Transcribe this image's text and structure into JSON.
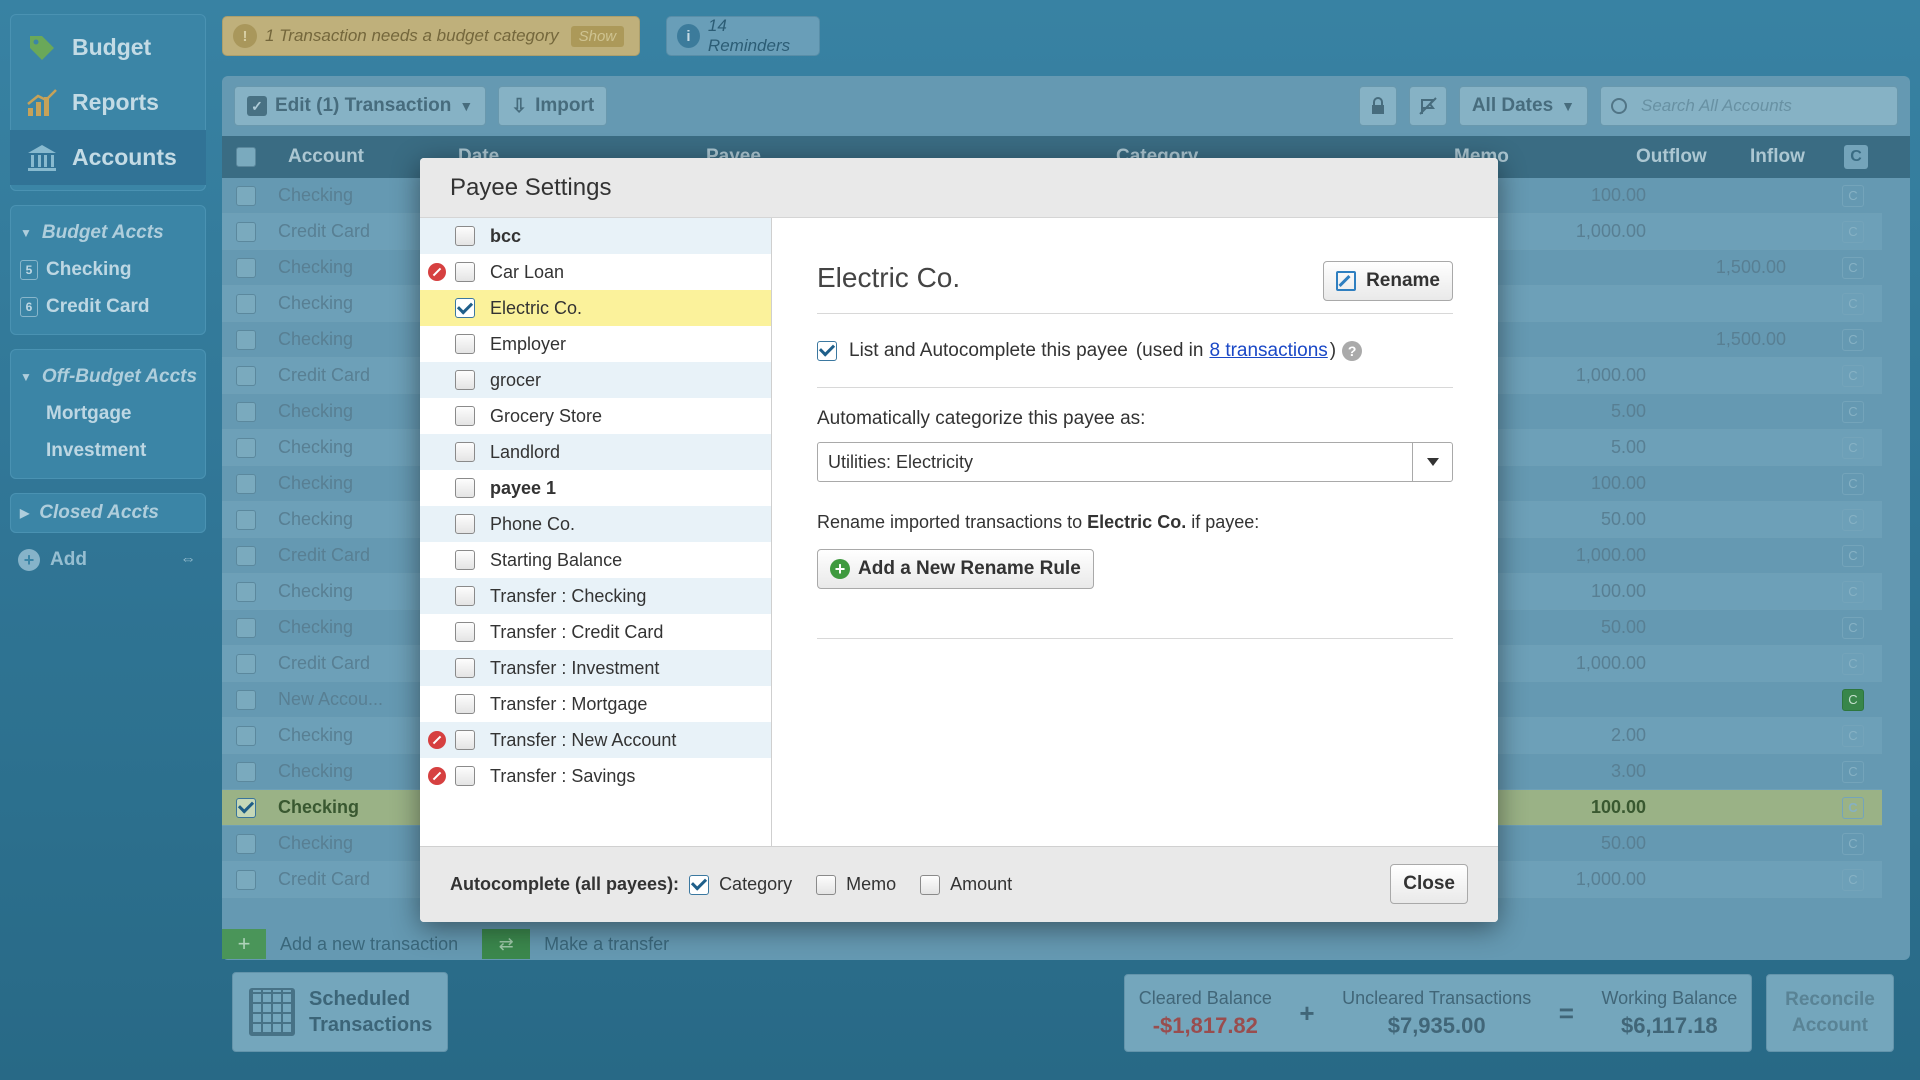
{
  "nav": {
    "items": [
      {
        "label": "Budget"
      },
      {
        "label": "Reports"
      },
      {
        "label": "Accounts"
      }
    ]
  },
  "accounts": {
    "budget_group": "Budget Accts",
    "budget_items": [
      {
        "label": "Checking",
        "badge": "5"
      },
      {
        "label": "Credit Card",
        "badge": "6"
      }
    ],
    "offbudget_group": "Off-Budget Accts",
    "offbudget_items": [
      "Mortgage",
      "Investment"
    ],
    "closed_group": "Closed Accts",
    "add_label": "Add"
  },
  "notices": {
    "warning_text": "1 Transaction needs a budget category",
    "warning_show": "Show",
    "reminders_text": "14 Reminders"
  },
  "toolbar": {
    "edit_label": "Edit (1) Transaction",
    "import_label": "Import",
    "dates_label": "All Dates",
    "search_placeholder": "Search All Accounts"
  },
  "columns": {
    "account": "Account",
    "date": "Date",
    "payee": "Payee",
    "category": "Category",
    "memo": "Memo",
    "outflow": "Outflow",
    "inflow": "Inflow",
    "cleared": "C"
  },
  "register_rows": [
    {
      "account": "Checking",
      "outflow": "100.00",
      "inflow": ""
    },
    {
      "account": "Credit Card",
      "outflow": "1,000.00",
      "inflow": ""
    },
    {
      "account": "Checking",
      "outflow": "",
      "inflow": "1,500.00"
    },
    {
      "account": "Checking",
      "outflow": "",
      "inflow": ""
    },
    {
      "account": "Checking",
      "outflow": "",
      "inflow": "1,500.00"
    },
    {
      "account": "Credit Card",
      "outflow": "1,000.00",
      "inflow": ""
    },
    {
      "account": "Checking",
      "outflow": "5.00",
      "inflow": ""
    },
    {
      "account": "Checking",
      "outflow": "5.00",
      "inflow": ""
    },
    {
      "account": "Checking",
      "outflow": "100.00",
      "inflow": ""
    },
    {
      "account": "Checking",
      "outflow": "50.00",
      "inflow": ""
    },
    {
      "account": "Credit Card",
      "outflow": "1,000.00",
      "inflow": ""
    },
    {
      "account": "Checking",
      "outflow": "100.00",
      "inflow": ""
    },
    {
      "account": "Checking",
      "outflow": "50.00",
      "inflow": ""
    },
    {
      "account": "Credit Card",
      "outflow": "1,000.00",
      "inflow": ""
    },
    {
      "account": "New Accou...",
      "outflow": "",
      "inflow": ""
    },
    {
      "account": "Checking",
      "outflow": "2.00",
      "inflow": ""
    },
    {
      "account": "Checking",
      "outflow": "3.00",
      "inflow": ""
    },
    {
      "account": "Checking",
      "outflow": "100.00",
      "inflow": ""
    },
    {
      "account": "Checking",
      "outflow": "50.00",
      "inflow": ""
    },
    {
      "account": "Credit Card",
      "outflow": "1,000.00",
      "inflow": ""
    }
  ],
  "register_footer": {
    "add_transaction": "Add a new transaction",
    "make_transfer": "Make a transfer"
  },
  "bottom": {
    "scheduled_line1": "Scheduled",
    "scheduled_line2": "Transactions",
    "cleared_label": "Cleared Balance",
    "cleared_value": "-$1,817.82",
    "uncleared_label": "Uncleared Transactions",
    "uncleared_value": "$7,935.00",
    "working_label": "Working Balance",
    "working_value": "$6,117.18",
    "reconcile_line1": "Reconcile",
    "reconcile_line2": "Account"
  },
  "dialog": {
    "title": "Payee Settings",
    "payees": [
      {
        "name": "bcc",
        "bold": true,
        "checked": false,
        "deletable": false
      },
      {
        "name": "Car Loan",
        "bold": false,
        "checked": false,
        "deletable": true
      },
      {
        "name": "Electric Co.",
        "bold": false,
        "checked": true,
        "deletable": false,
        "selected": true
      },
      {
        "name": "Employer",
        "bold": false,
        "checked": false,
        "deletable": false
      },
      {
        "name": "grocer",
        "bold": false,
        "checked": false,
        "deletable": false
      },
      {
        "name": "Grocery Store",
        "bold": false,
        "checked": false,
        "deletable": false
      },
      {
        "name": "Landlord",
        "bold": false,
        "checked": false,
        "deletable": false
      },
      {
        "name": "payee 1",
        "bold": true,
        "checked": false,
        "deletable": false
      },
      {
        "name": "Phone Co.",
        "bold": false,
        "checked": false,
        "deletable": false
      },
      {
        "name": "Starting Balance",
        "bold": false,
        "checked": false,
        "deletable": false
      },
      {
        "name": "Transfer : Checking",
        "bold": false,
        "checked": false,
        "deletable": false
      },
      {
        "name": "Transfer : Credit Card",
        "bold": false,
        "checked": false,
        "deletable": false
      },
      {
        "name": "Transfer : Investment",
        "bold": false,
        "checked": false,
        "deletable": false
      },
      {
        "name": "Transfer : Mortgage",
        "bold": false,
        "checked": false,
        "deletable": false
      },
      {
        "name": "Transfer : New Account",
        "bold": false,
        "checked": false,
        "deletable": true
      },
      {
        "name": "Transfer : Savings",
        "bold": false,
        "checked": false,
        "deletable": true
      }
    ],
    "detail": {
      "payee_name": "Electric Co.",
      "rename_label": "Rename",
      "list_label": "List and Autocomplete this payee",
      "used_in_prefix": "(used in",
      "used_in_link": "8 transactions",
      "used_in_suffix": ")",
      "help_glyph": "?",
      "categorize_label": "Automatically categorize this payee as:",
      "category_value": "Utilities: Electricity",
      "rename_rule_prefix": "Rename imported transactions to",
      "rename_rule_name": "Electric Co.",
      "rename_rule_suffix": "if payee:",
      "add_rule_label": "Add a New Rename Rule"
    },
    "footer": {
      "autocomplete_label": "Autocomplete (all payees):",
      "category": "Category",
      "memo": "Memo",
      "amount": "Amount",
      "close_label": "Close"
    }
  }
}
